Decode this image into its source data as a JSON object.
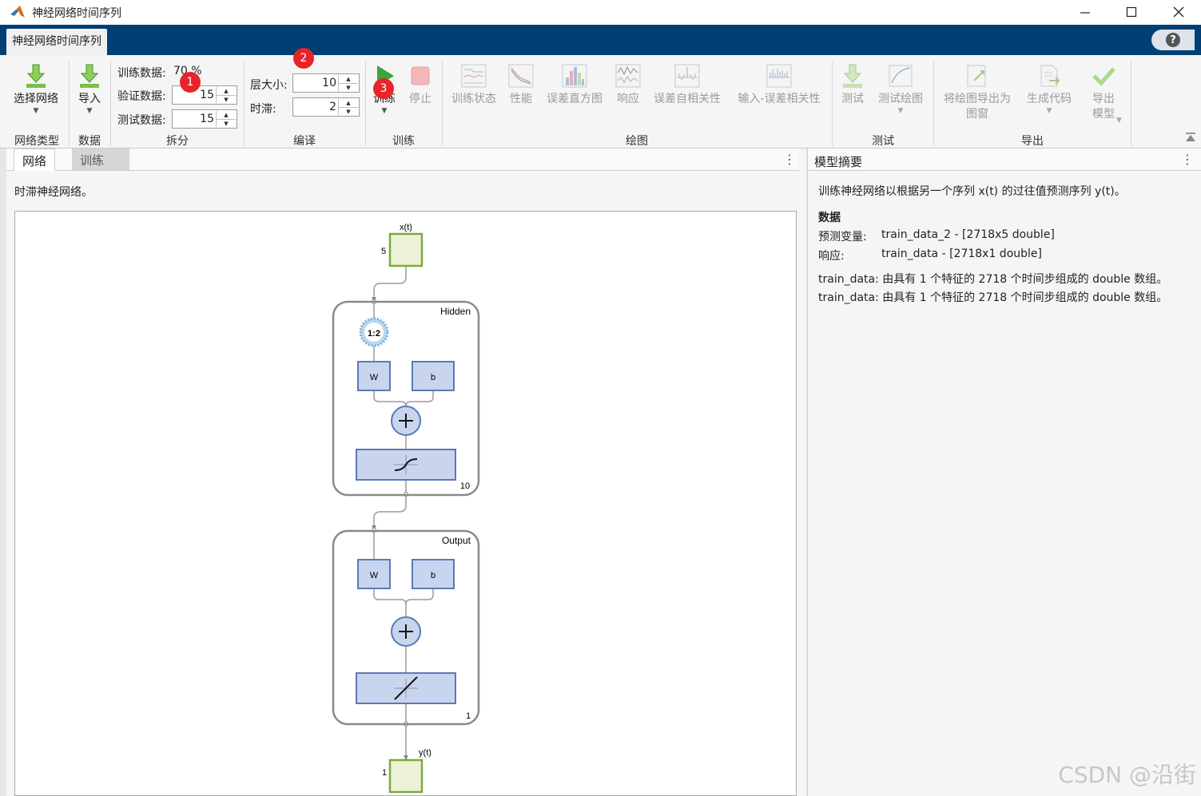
{
  "window": {
    "title": "神经网络时间序列"
  },
  "tabstrip": {
    "app_tab": "神经网络时间序列",
    "help_glyph": "?"
  },
  "ribbon": {
    "network_type": {
      "button": "选择网络",
      "group": "网络类型"
    },
    "data": {
      "button": "导入",
      "group": "数据"
    },
    "split": {
      "group": "拆分",
      "train_label": "训练数据:",
      "train_value": "70 %",
      "validation_label": "验证数据:",
      "validation_value": "15",
      "test_label": "测试数据:",
      "test_value": "15"
    },
    "compile": {
      "group": "编译",
      "layer_size_label": "层大小:",
      "layer_size_value": "10",
      "delay_label": "时滞:",
      "delay_value": "2"
    },
    "train": {
      "group": "训练",
      "train_button": "训练",
      "stop_button": "停止"
    },
    "plots": {
      "group": "绘图",
      "items": [
        "训练状态",
        "性能",
        "误差直方图",
        "响应",
        "误差自相关性",
        "输入-误差相关性"
      ]
    },
    "test": {
      "group": "测试",
      "test_button": "测试",
      "test_plot_button": "测试绘图"
    },
    "export": {
      "group": "导出",
      "export_figure": "将绘图导出为\n图窗",
      "generate_code": "生成代码",
      "export_model": "导出\n模型"
    },
    "badges": [
      "1",
      "2",
      "3"
    ]
  },
  "left_pane": {
    "tabs": [
      "网络",
      "训练"
    ],
    "caption": "时滞神经网络。",
    "diagram": {
      "input_label": "x(t)",
      "input_size": "5",
      "hidden_title": "Hidden",
      "hidden_size": "10",
      "delay_label": "1:2",
      "weight_label": "W",
      "bias_label": "b",
      "output_title": "Output",
      "output_size": "1",
      "output_label": "y(t)",
      "final_size": "1"
    }
  },
  "right_pane": {
    "title": "模型摘要",
    "description": "训练神经网络以根据另一个序列 x(t) 的过往值预测序列 y(t)。",
    "data_heading": "数据",
    "predictor_label": "预测变量:",
    "predictor_value": "train_data_2 - [2718x5 double]",
    "response_label": "响应:",
    "response_value": "train_data - [2718x1 double]",
    "note_1": "train_data: 由具有 1 个特征的 2718 个时间步组成的 double 数组。",
    "note_2": "train_data: 由具有 1 个特征的 2718 个时间步组成的 double 数组。"
  },
  "watermark": "CSDN @沿街",
  "colors": {
    "tabstrip": "#003f74",
    "badge": "#e8242b",
    "train_icon": "#3aa63a",
    "node_fill": "#c9d5ee",
    "node_stroke": "#5b79b8",
    "io_fill": "#eef1d8",
    "io_stroke": "#7aab3a"
  }
}
